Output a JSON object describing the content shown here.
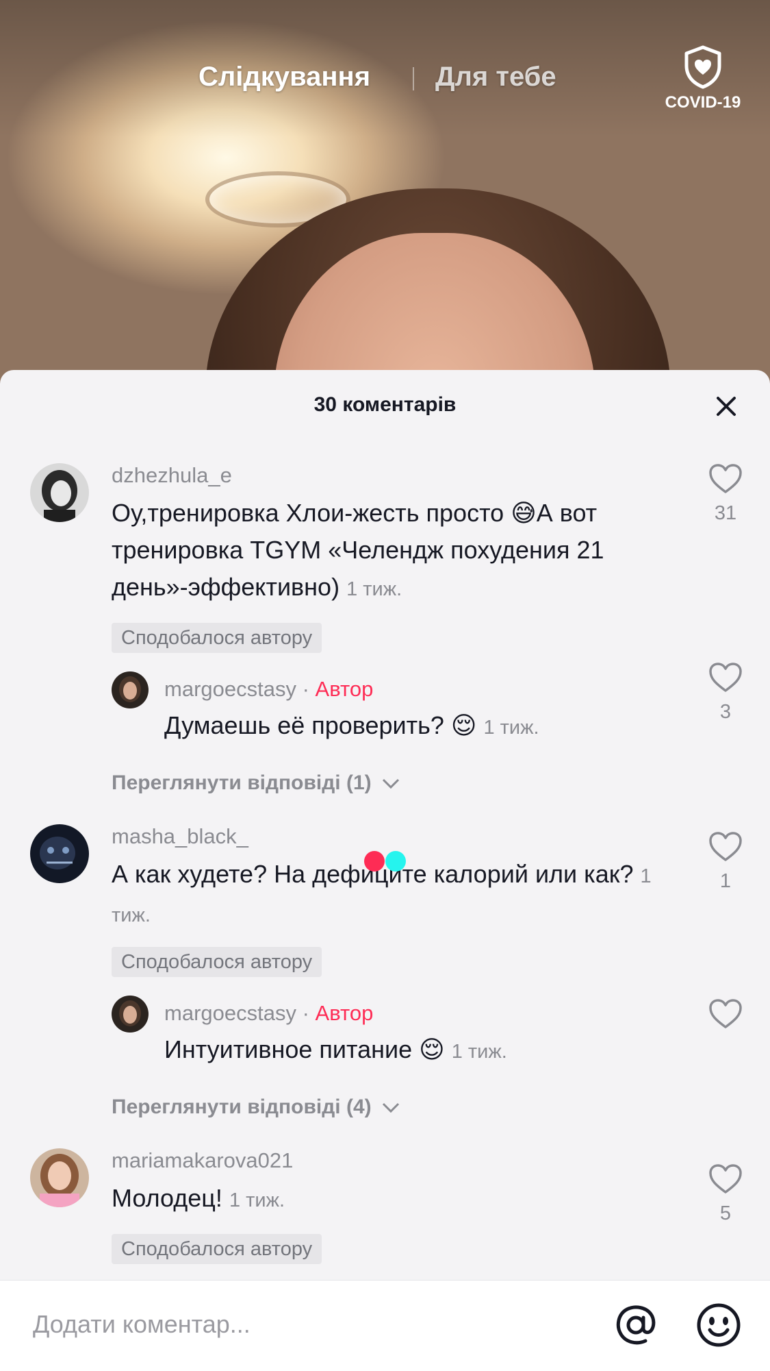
{
  "top_nav": {
    "following_label": "Слідкування",
    "for_you_label": "Для тебе",
    "covid_label": "COVID-19"
  },
  "comments_sheet": {
    "title": "30 коментарів",
    "comments": [
      {
        "username": "dzhezhula_e",
        "text": "Оу,тренировка Хлои-жесть просто 😅А вот тренировка TGYM «Челендж похудения 21 день»-эффективно)",
        "time": "1 тиж.",
        "liked_by_author": "Сподобалося автору",
        "like_count": "31",
        "reply": {
          "username": "margoecstasy",
          "separator": "·",
          "badge": "Автор",
          "text": "Думаешь её проверить? 😌",
          "time": "1 тиж.",
          "like_count": "3"
        },
        "view_replies": "Переглянути відповіді (1)"
      },
      {
        "username": "masha_black_",
        "text": "А как худете? На дефиците калорий или как?",
        "time": "1 тиж.",
        "liked_by_author": "Сподобалося автору",
        "like_count": "1",
        "reply": {
          "username": "margoecstasy",
          "separator": "·",
          "badge": "Автор",
          "text": "Интуитивное питание 😌",
          "time": "1 тиж.",
          "like_count": ""
        },
        "view_replies": "Переглянути відповіді (4)"
      },
      {
        "username": "mariamakarova021",
        "text": "Молодец!",
        "time": "1 тиж.",
        "liked_by_author": "Сподобалося автору",
        "like_count": "5"
      }
    ]
  },
  "input_bar": {
    "placeholder": "Додати коментар..."
  },
  "colors": {
    "author_badge": "#fe2c55",
    "loading_dot_red": "#fe2c55",
    "loading_dot_cyan": "#25f4ee",
    "sheet_background": "#f4f3f5"
  }
}
